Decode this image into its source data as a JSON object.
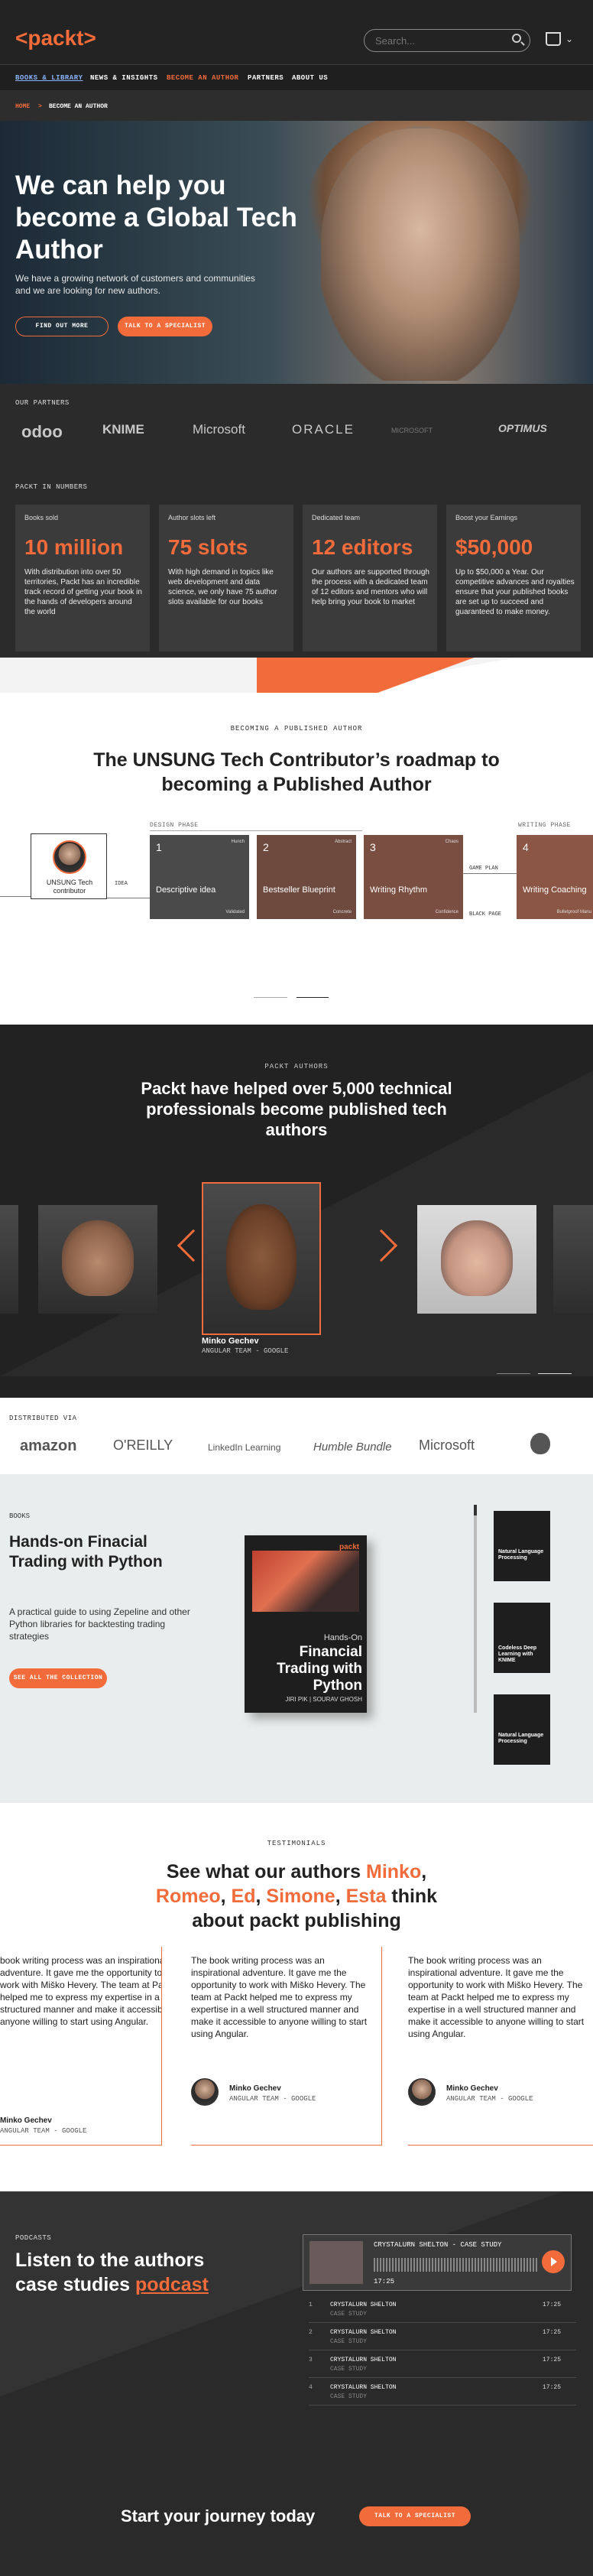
{
  "nav": {
    "logo": "<packt>",
    "search_placeholder": "Search...",
    "cart_dropdown": "⌄",
    "menu": [
      "BOOKS & LIBRARY",
      "NEWS & INSIGHTS",
      "BECOME AN AUTHOR",
      "PARTNERS",
      "ABOUT US"
    ],
    "breadcrumb_home": "HOME",
    "breadcrumb_sep": ">",
    "breadcrumb_current": "BECOME AN AUTHOR"
  },
  "hero": {
    "title": "We can help you become a Global Tech Author",
    "subtitle": "We have a growing network of customers and communities and we are looking for new authors.",
    "btn_find": "FIND OUT MORE",
    "btn_talk": "TALK TO A SPECIALIST"
  },
  "partners": {
    "label": "OUR PARTNERS",
    "logos": [
      "odoo",
      "KNIME",
      "Microsoft",
      "ORACLE",
      "MICROSOFT",
      "OPTIMUS"
    ]
  },
  "numbers": {
    "label": "PACKT IN NUMBERS",
    "cards": [
      {
        "label": "Books sold",
        "value": "10 million",
        "desc": "With distribution into over 50 territories, Packt has an incredible track record of getting your book in the hands of developers around the world"
      },
      {
        "label": "Author slots left",
        "value": "75 slots",
        "desc": "With high demand in topics like web development and data science, we only have 75 author slots available for our books"
      },
      {
        "label": "Dedicated team",
        "value": "12 editors",
        "desc": "Our authors are supported through the process with a dedicated team of 12 editors and mentors who will help bring your book to market"
      },
      {
        "label": "Boost your Earnings",
        "value": "$50,000",
        "desc": "Up to $50,000 a Year. Our competitive advances and royalties ensure that your published books are set up to succeed and guaranteed to make money."
      }
    ]
  },
  "roadmap": {
    "label": "BECOMING A PUBLISHED AUTHOR",
    "title": "The UNSUNG Tech Contributor’s roadmap to becoming a Published Author",
    "design_phase": "DESIGN PHASE",
    "writing_phase": "WRITING PHASE",
    "contributor": "UNSUNG Tech contributor",
    "idea": "IDEA",
    "game_plan": "GAME PLAN",
    "black_page": "BLACK PAGE",
    "steps": [
      {
        "num": "1",
        "title": "Descriptive idea",
        "tag_top": "Hunch",
        "tag_bottom": "Validated"
      },
      {
        "num": "2",
        "title": "Bestseller Blueprint",
        "tag_top": "Abstract",
        "tag_bottom": "Concrete"
      },
      {
        "num": "3",
        "title": "Writing Rhythm",
        "tag_top": "Chaos",
        "tag_bottom": "Confidence"
      },
      {
        "num": "4",
        "title": "Writing Coaching",
        "tag_top": "",
        "tag_bottom": "Bulletproof Manu"
      }
    ]
  },
  "authors": {
    "label": "PACKT AUTHORS",
    "title": "Packt have helped over 5,000 technical professionals become published tech authors",
    "featured_name": "Minko Gechev",
    "featured_role": "ANGULAR TEAM - GOOGLE"
  },
  "distributors": {
    "label": "DISTRIBUTED VIA",
    "logos": [
      "amazon",
      "O'REILLY",
      "LinkedIn Learning",
      "Humble Bundle",
      "Microsoft",
      ""
    ]
  },
  "book": {
    "label": "BOOKS",
    "title": "Hands-on Finacial Trading with Python",
    "desc": "A practical guide to using Zepeline and other Python libraries for backtesting trading strategies",
    "btn": "SEE ALL THE COLLECTION",
    "cover_brand": "packt",
    "cover_top": "Hands-On",
    "cover_title": "Financial Trading with Python",
    "cover_authors": "JIRI PIK | SOURAV GHOSH",
    "thumbs": [
      "Natural Language Processing",
      "Codeless Deep Learning with KNIME",
      "Natural Language Processing"
    ]
  },
  "testimonials": {
    "label": "TESTIMONIALS",
    "title_pre": "See what our authors ",
    "names": [
      "Minko",
      "Romeo",
      "Ed",
      "Simone",
      "Esta"
    ],
    "sep1": ", ",
    "sep2": ", ",
    "sep3": ", ",
    "sep4": ", ",
    "title_post": " think about packt publishing",
    "quote_partial": "book writing process was an inspirational adventure. It gave me the opportunity to work with Miško Hevery. The team at Packt helped me to express my expertise in a well structured manner and make it accessible to anyone willing to start using Angular.",
    "quote": "The book writing process was an inspirational adventure. It gave me the opportunity to work with Miško Hevery. The team at Packt helped me to express my expertise in a well structured manner and make it accessible to anyone willing to start using Angular.",
    "name": "Minko Gechev",
    "role": "ANGULAR TEAM - GOOGLE"
  },
  "podcasts": {
    "label": "PODCASTS",
    "title_pre": "Listen to the authors case studies ",
    "title_link": "podcast",
    "player_title": "CRYSTALURN SHELTON - CASE STUDY",
    "player_time": "17:25",
    "episodes": [
      {
        "num": "1",
        "title": "CRYSTALURN SHELTON",
        "sub": "CASE STUDY",
        "dur": "17:25"
      },
      {
        "num": "2",
        "title": "CRYSTALURN SHELTON",
        "sub": "CASE STUDY",
        "dur": "17:25"
      },
      {
        "num": "3",
        "title": "CRYSTALURN SHELTON",
        "sub": "CASE STUDY",
        "dur": "17:25"
      },
      {
        "num": "4",
        "title": "CRYSTALURN SHELTON",
        "sub": "CASE STUDY",
        "dur": "17:25"
      }
    ]
  },
  "journey": {
    "title": "Start your journey today",
    "btn": "TALK TO A SPECIALIST"
  },
  "colors": {
    "accent": "#f26b3a",
    "dark": "#2b2b2b",
    "card": "#3b3b3b",
    "step_brown": "#6e4a3e"
  }
}
